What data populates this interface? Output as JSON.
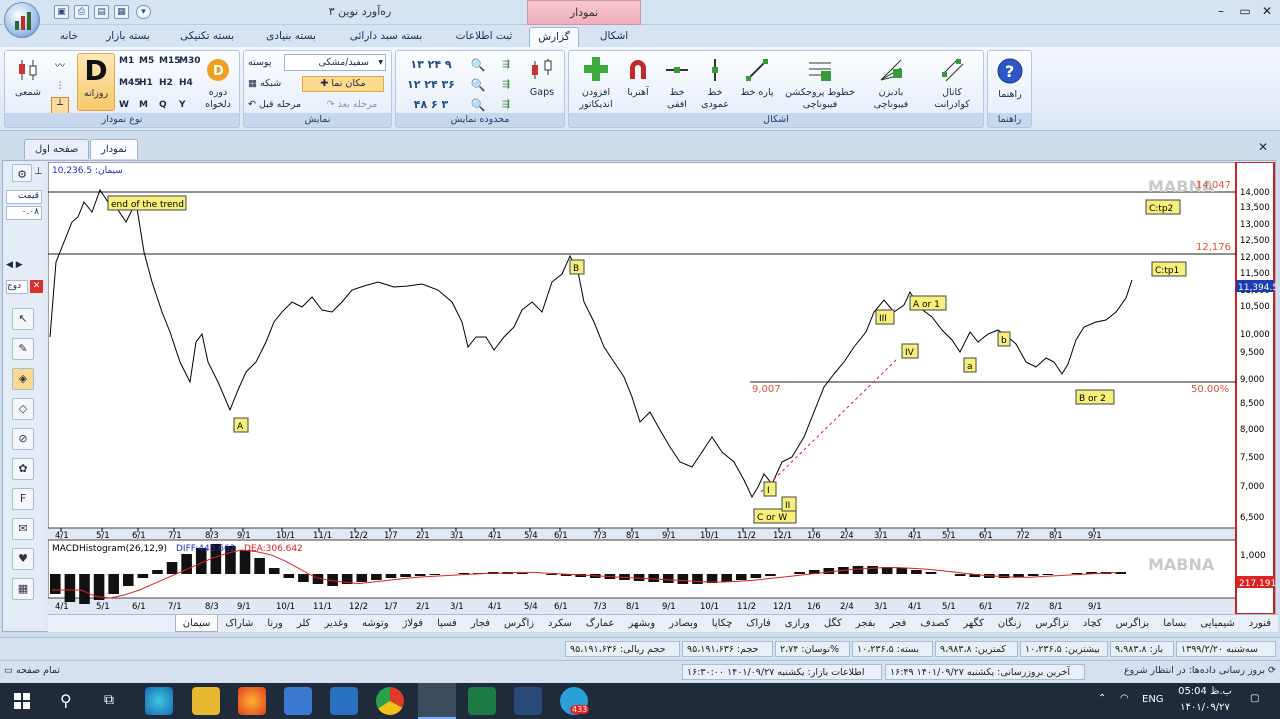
{
  "app": {
    "title": "ره‌آورد نوین ۳",
    "context_tab": "نمودار"
  },
  "ribbon_tabs": [
    "خانه",
    "بسته بازار",
    "بسته تکنیکی",
    "بسته بنیادی",
    "بسته سبد دارائی",
    "ثبت اطلاعات",
    "گزارش",
    "اشکال"
  ],
  "active_tab": "گزارش",
  "groups": {
    "chart_type": {
      "title": "نوع نمودار",
      "candle": "شمعی",
      "daily": "روزانه",
      "period": "دوره دلخواه",
      "intervals": [
        "M1",
        "M5",
        "M15",
        "M30",
        "M45",
        "H1",
        "H2",
        "H4",
        "W",
        "M",
        "Q",
        "Y"
      ]
    },
    "display": {
      "title": "نمایش",
      "skin_label": "پوسته",
      "skin_value": "سفید/مشکی",
      "grid": "شبکه",
      "magnifier": "مکان نما",
      "next_step": "مرحله بعد",
      "prev_step": "مرحله قبل"
    },
    "display_range": {
      "title": "محدوده نمایش",
      "gaps": "Gaps"
    },
    "shapes": {
      "title": "اشکال",
      "add_indicator": "افزودن اندیکاتور",
      "magnet": "آهنربا",
      "hline": "خط افقی",
      "vline": "خط عمودی",
      "segment": "پاره خط",
      "fibo_proj": "خطوط پروجکشن فیبوناچی",
      "fibo_fan": "بادبزن فیبوناچی",
      "channel": "کانال کوادرانت"
    },
    "help": {
      "title": "راهنما",
      "label": "راهنما"
    }
  },
  "doc_tabs": [
    "نمودار",
    "صفحه اول"
  ],
  "left_tools": {
    "price_label": "قیمت",
    "price_value": "۰.۰۸",
    "compare": "دوج"
  },
  "chart": {
    "symbol_label": "سیمان: 10,236.5",
    "watermark": "MABNA",
    "price_axis": [
      "14,000",
      "13,500",
      "13,000",
      "12,500",
      "12,000",
      "11,500",
      "11,000",
      "10,500",
      "10,000",
      "9,500",
      "9,000",
      "8,500",
      "8,000",
      "7,500",
      "7,000",
      "6,500"
    ],
    "current_price": "11,394.5",
    "x_labels": [
      "4/1",
      "5/1",
      "6/1",
      "7/1",
      "8/3",
      "9/1",
      "10/1",
      "11/1",
      "12/2",
      "1/7",
      "2/1",
      "3/1",
      "4/1",
      "5/4",
      "6/1",
      "7/3",
      "8/1",
      "9/1",
      "10/1",
      "11/2",
      "12/1",
      "1/6",
      "2/4",
      "3/1",
      "4/1",
      "5/1",
      "6/1",
      "7/2",
      "8/1",
      "9/1"
    ],
    "level_labels": {
      "l14": "14,047",
      "l12": "12,176",
      "l9": "9,007",
      "pct": "50.00%"
    },
    "annotations": [
      "end of the trend",
      "A",
      "B",
      "C or W",
      "I",
      "II",
      "III",
      "IV",
      "A or 1",
      "a",
      "b",
      "B or 2",
      "C:tp1",
      "C:tp2"
    ],
    "macd_label": "MACDHistogram(26,12,9)",
    "diff": "DIFF:443.662",
    "dea": "DEA:306.642",
    "macd_axis": "1,000",
    "macd_value": "217.191"
  },
  "sheet_tabs": [
    "فنورد",
    "شیمیایی",
    "بساما",
    "بزاگرس",
    "کچاد",
    "تزاگرس",
    "زنگان",
    "کگهر",
    "کصدف",
    "فجر",
    "بفجر",
    "کگل",
    "ورازی",
    "فاراک",
    "چکاپا",
    "وبصادر",
    "وبشهر",
    "عمارگ",
    "سکرد",
    "زاگرس",
    "فجار",
    "فسپا",
    "فولاژ",
    "وتوشه",
    "وغدیر",
    "کلر",
    "ورنا",
    "شاراک",
    "سیمان"
  ],
  "active_sheet": "سیمان",
  "status": {
    "date": "سه‌شنبه ۱۳۹۹/۲/۲۰",
    "open": "باز: ۹،۹۸۳،۸",
    "high": "بیشترین: ۱۰،۲۳۶،۵",
    "low": "کمترین: ۹،۹۸۳،۸",
    "close": "بسته: ۱۰،۲۳۶،۵",
    "change": "نوسان: ۲،۷۴%",
    "volume": "حجم: ۹۵،۱۹۱،۶۳۶",
    "vol_rial": "حجم ریالی: ۹۵،۱۹۱،۶۳۶",
    "vol2": "۹۵،۱۹۱،۶۳۶"
  },
  "status2": {
    "update": "بروز رسانی داده‌ها: در انتظار شروع",
    "last": "آخرین بروزرسانی: یکشنبه ۱۴۰۱/۰۹/۲۷ ۱۶:۴۹",
    "market": "اطلاعات بازار: یکشنبه ۱۴۰۱/۰۹/۲۷ ۱۶:۳۰:۰۰",
    "fullpage": "تمام صفحه"
  },
  "taskbar": {
    "lang": "ENG",
    "time": "05:04 ب.ظ",
    "date": "۱۴۰۱/۰۹/۲۷",
    "badge": "433"
  }
}
